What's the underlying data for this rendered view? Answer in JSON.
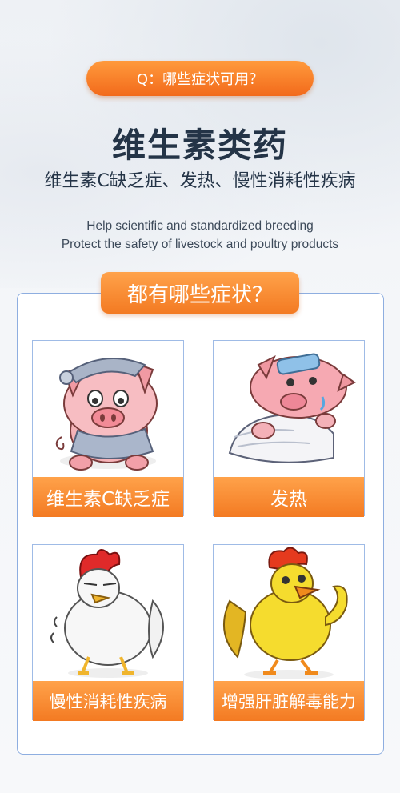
{
  "question_pill": {
    "label": "Q：哪些症状可用？"
  },
  "header": {
    "title": "维生素类药",
    "subtitle": "维生素C缺乏症、发热、慢性消耗性疾病",
    "english_line1": "Help scientific and standardized breeding",
    "english_line2": "Protect the safety of livestock and poultry products"
  },
  "panel": {
    "tab_label": "都有哪些症状？",
    "cards": [
      {
        "label": "维生素C缺乏症",
        "icon": "sick-pig-nightcap"
      },
      {
        "label": "发热",
        "icon": "feverish-pig-in-bed"
      },
      {
        "label": "慢性消耗性疾病",
        "icon": "weak-chicken"
      },
      {
        "label": "增强肝脏解毒能力",
        "icon": "strong-rooster"
      }
    ]
  },
  "colors": {
    "accent_orange": "#f37a22",
    "title_navy": "#243447",
    "border_blue": "#8eaee0"
  }
}
